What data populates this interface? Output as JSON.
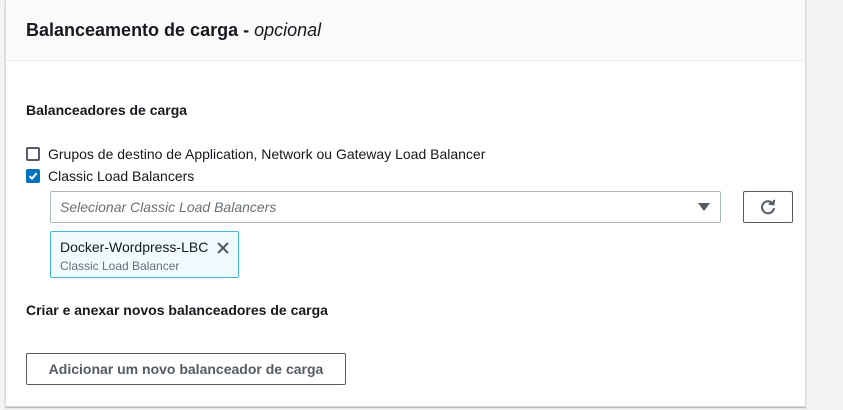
{
  "panel": {
    "title": "Balanceamento de carga - ",
    "title_suffix": "opcional"
  },
  "load_balancers": {
    "label": "Balanceadores de carga",
    "options": [
      {
        "label": "Grupos de destino de Application, Network ou Gateway Load Balancer",
        "checked": false
      },
      {
        "label": "Classic Load Balancers",
        "checked": true
      }
    ],
    "select": {
      "placeholder": "Selecionar Classic Load Balancers",
      "caret_icon": "caret-down-icon"
    },
    "refresh_icon": "refresh-icon",
    "selected_tokens": [
      {
        "title": "Docker-Wordpress-LBC",
        "subtitle": "Classic Load Balancer",
        "close_icon": "close-icon"
      }
    ]
  },
  "create_section": {
    "label": "Criar e anexar novos balanceadores de carga",
    "add_button_label": "Adicionar um novo balanceador de carga"
  },
  "colors": {
    "accent": "#0073bb",
    "token_border": "#44b9d6",
    "token_bg": "#f1faff"
  }
}
